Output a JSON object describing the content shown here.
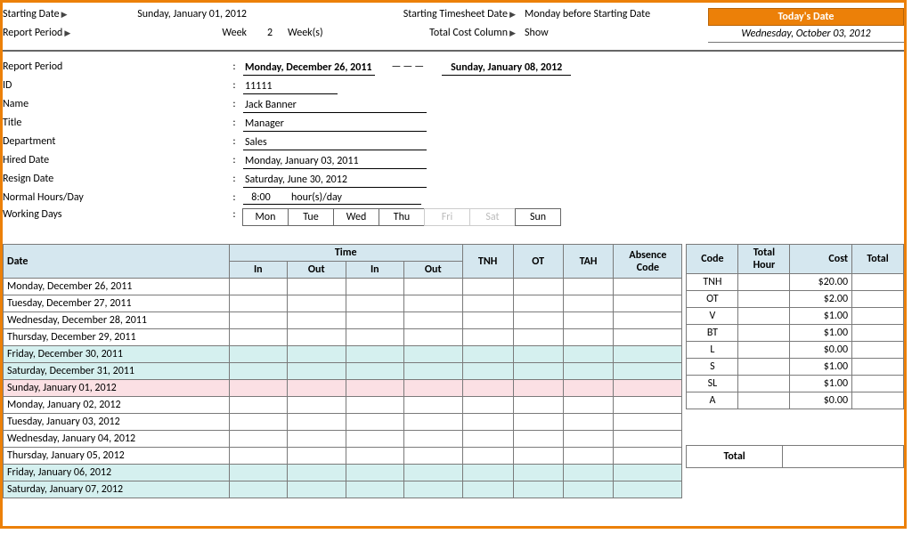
{
  "settings": {
    "starting_date_label": "Starting Date",
    "starting_date_value": "Sunday, January 01, 2012",
    "report_period_label": "Report Period",
    "report_period_week_label": "Week",
    "report_period_week_value": "2",
    "report_period_weeks_label": "Week(s)",
    "starting_ts_label": "Starting Timesheet Date",
    "starting_ts_value": "Monday before Starting Date",
    "total_cost_label": "Total Cost Column",
    "total_cost_value": "Show"
  },
  "todays_date": {
    "label": "Today's Date",
    "value": "Wednesday, October 03, 2012"
  },
  "info": {
    "report_period_label": "Report Period",
    "report_period_start": "Monday, December 26, 2011",
    "report_period_dash": "———",
    "report_period_end": "Sunday, January 08, 2012",
    "id_label": "ID",
    "id_value": "11111",
    "name_label": "Name",
    "name_value": "Jack Banner",
    "title_label": "Title",
    "title_value": "Manager",
    "department_label": "Department",
    "department_value": "Sales",
    "hired_label": "Hired Date",
    "hired_value": "Monday, January 03, 2011",
    "resign_label": "Resign Date",
    "resign_value": "Saturday, June 30, 2012",
    "normal_hours_label": "Normal Hours/Day",
    "normal_hours_value": "8:00",
    "normal_hours_unit": "hour(s)/day",
    "working_days_label": "Working Days",
    "days": [
      "Mon",
      "Tue",
      "Wed",
      "Thu",
      "Fri",
      "Sat",
      "Sun"
    ],
    "days_off": [
      false,
      false,
      false,
      false,
      true,
      true,
      false
    ]
  },
  "timesheet": {
    "headers": {
      "date": "Date",
      "time": "Time",
      "in": "In",
      "out": "Out",
      "tnh": "TNH",
      "ot": "OT",
      "tah": "TAH",
      "absence": "Absence Code"
    },
    "rows": [
      {
        "date": "Monday, December 26, 2011",
        "kind": "normal"
      },
      {
        "date": "Tuesday, December 27, 2011",
        "kind": "normal"
      },
      {
        "date": "Wednesday, December 28, 2011",
        "kind": "normal"
      },
      {
        "date": "Thursday, December 29, 2011",
        "kind": "normal"
      },
      {
        "date": "Friday, December 30, 2011",
        "kind": "weekend"
      },
      {
        "date": "Saturday, December 31, 2011",
        "kind": "weekend"
      },
      {
        "date": "Sunday, January 01, 2012",
        "kind": "special"
      },
      {
        "date": "Monday, January 02, 2012",
        "kind": "normal"
      },
      {
        "date": "Tuesday, January 03, 2012",
        "kind": "normal"
      },
      {
        "date": "Wednesday, January 04, 2012",
        "kind": "normal"
      },
      {
        "date": "Thursday, January 05, 2012",
        "kind": "normal"
      },
      {
        "date": "Friday, January 06, 2012",
        "kind": "weekend"
      },
      {
        "date": "Saturday, January 07, 2012",
        "kind": "weekend"
      }
    ]
  },
  "codes": {
    "headers": {
      "code": "Code",
      "hour": "Total Hour",
      "cost": "Cost",
      "total": "Total"
    },
    "rows": [
      {
        "code": "TNH",
        "hour": "",
        "cost": "$20.00",
        "total": ""
      },
      {
        "code": "OT",
        "hour": "",
        "cost": "$2.00",
        "total": ""
      },
      {
        "code": "V",
        "hour": "",
        "cost": "$1.00",
        "total": ""
      },
      {
        "code": "BT",
        "hour": "",
        "cost": "$1.00",
        "total": ""
      },
      {
        "code": "L",
        "hour": "",
        "cost": "$0.00",
        "total": ""
      },
      {
        "code": "S",
        "hour": "",
        "cost": "$1.00",
        "total": ""
      },
      {
        "code": "SL",
        "hour": "",
        "cost": "$1.00",
        "total": ""
      },
      {
        "code": "A",
        "hour": "",
        "cost": "$0.00",
        "total": ""
      }
    ],
    "grand_total_label": "Total"
  }
}
